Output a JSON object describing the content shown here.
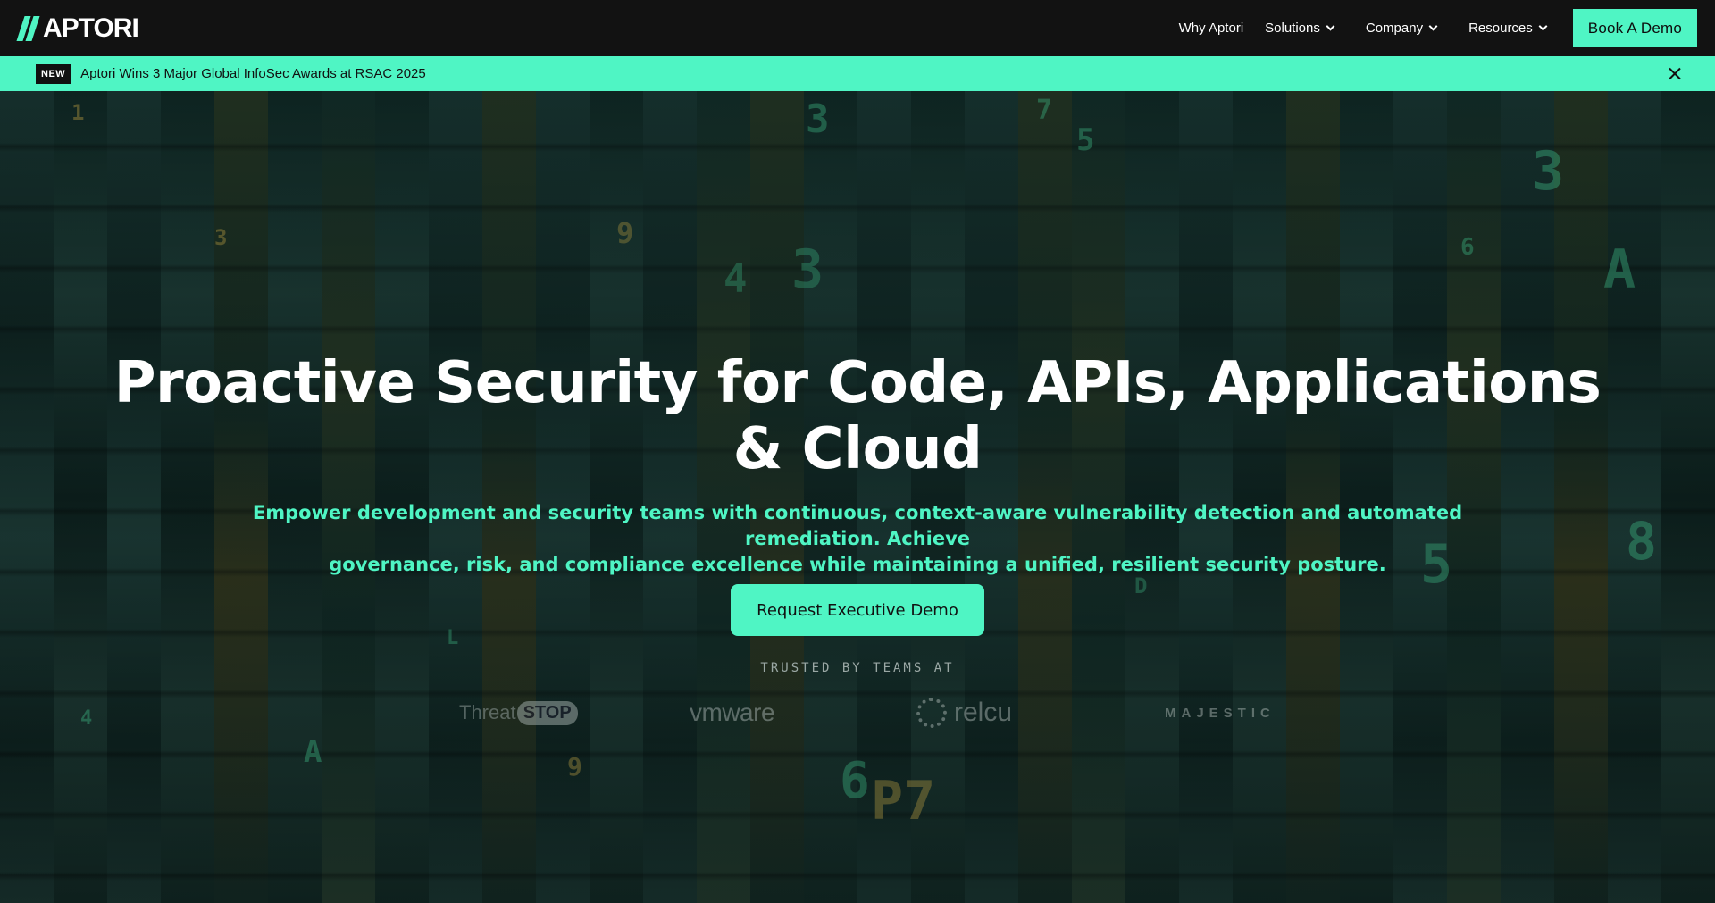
{
  "nav": {
    "logo_text": "APTORI",
    "links": [
      {
        "label": "Why Aptori"
      },
      {
        "label": "Solutions"
      },
      {
        "label": "Company"
      },
      {
        "label": "Resources"
      }
    ],
    "cta_label": "Book A Demo"
  },
  "announcement": {
    "badge": "NEW",
    "text": "Aptori Wins 3 Major Global InfoSec Awards at RSAC 2025"
  },
  "hero": {
    "headline_line1": "Proactive Security for Code, APIs, Applications",
    "headline_line2": "& Cloud",
    "subhead_line1": "Empower development and security teams with continuous, context-aware vulnerability detection and automated remediation. Achieve",
    "subhead_line2": "governance, risk, and compliance excellence while maintaining a unified, resilient security posture.",
    "cta_label": "Request Executive Demo",
    "trusted_label": "TRUSTED BY TEAMS AT",
    "clients": {
      "threatstop_a": "Threat",
      "threatstop_b": "STOP",
      "vmware": "vmware",
      "relcu": "relcu",
      "majestic": "MAJESTIC"
    }
  },
  "colors": {
    "accent": "#4ff5c4",
    "nav_bg": "#121212"
  }
}
